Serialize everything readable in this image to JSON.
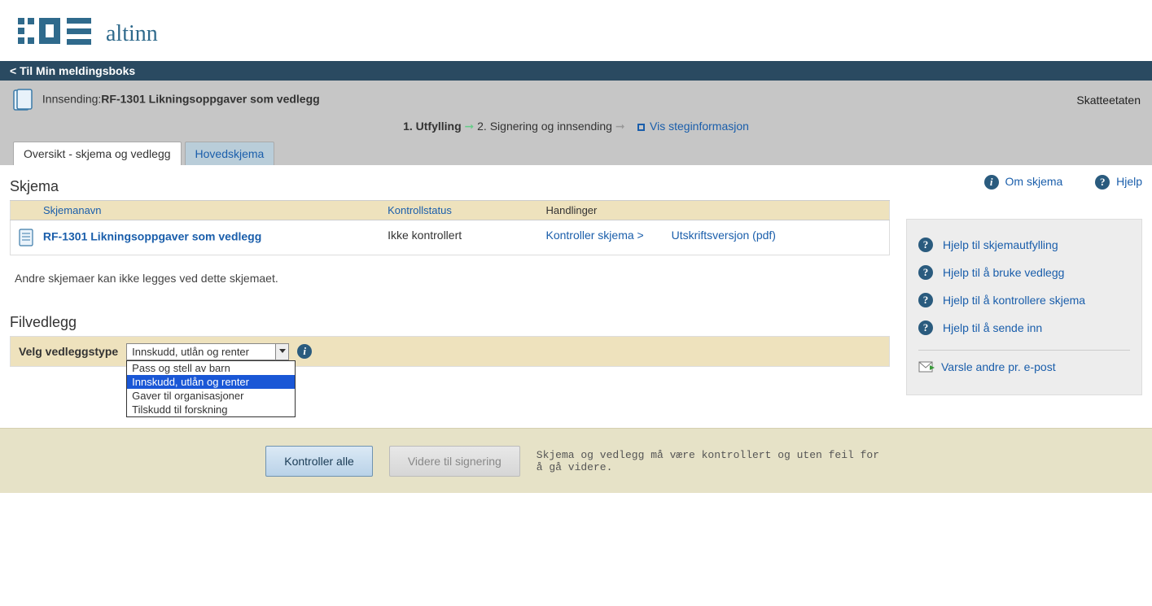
{
  "brand": "altinn",
  "topnav": {
    "back_label": "Til Min meldingsboks"
  },
  "header": {
    "prefix": "Innsending:",
    "title": "RF-1301 Likningsoppgaver som vedlegg",
    "agency": "Skatteetaten"
  },
  "steps": {
    "s1": "1.  Utfylling",
    "s2": "2.  Signering og innsending",
    "info_link": "Vis steginformasjon"
  },
  "tabs": {
    "overview": "Oversikt - skjema og vedlegg",
    "main": "Hovedskjema"
  },
  "top_links": {
    "about": "Om skjema",
    "help": "Hjelp"
  },
  "skjema": {
    "heading": "Skjema",
    "cols": {
      "name": "Skjemanavn",
      "status": "Kontrollstatus",
      "actions": "Handlinger"
    },
    "row": {
      "name": "RF-1301 Likningsoppgaver som vedlegg",
      "status": "Ikke kontrollert",
      "action_check": "Kontroller skjema >",
      "action_print": "Utskriftsversjon (pdf)"
    },
    "note": "Andre skjemaer kan ikke legges ved dette skjemaet."
  },
  "filvedlegg": {
    "heading": "Filvedlegg",
    "label": "Velg vedleggstype",
    "selected": "Innskudd, utlån og renter",
    "options": [
      "Pass og stell av barn",
      "Innskudd, utlån og renter",
      "Gaver til organisasjoner",
      "Tilskudd til forskning"
    ]
  },
  "side_help": {
    "h1": "Hjelp til skjemautfylling",
    "h2": "Hjelp til å bruke vedlegg",
    "h3": "Hjelp til å kontrollere skjema",
    "h4": "Hjelp til å sende inn",
    "notify": "Varsle andre pr. e-post"
  },
  "footer": {
    "btn_check": "Kontroller alle",
    "btn_next": "Videre til signering",
    "text": "Skjema og vedlegg må være kontrollert og uten feil for å gå videre."
  }
}
